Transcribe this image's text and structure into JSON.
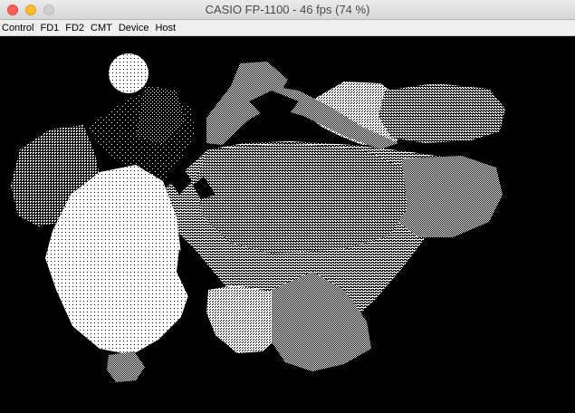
{
  "window": {
    "title": "CASIO FP-1100 - 46 fps (74 %)"
  },
  "menu": {
    "items": [
      "Control",
      "FD1",
      "FD2",
      "CMT",
      "Device",
      "Host"
    ]
  },
  "colors": {
    "screen_background": "#000000",
    "pixel": "#ffffff"
  }
}
